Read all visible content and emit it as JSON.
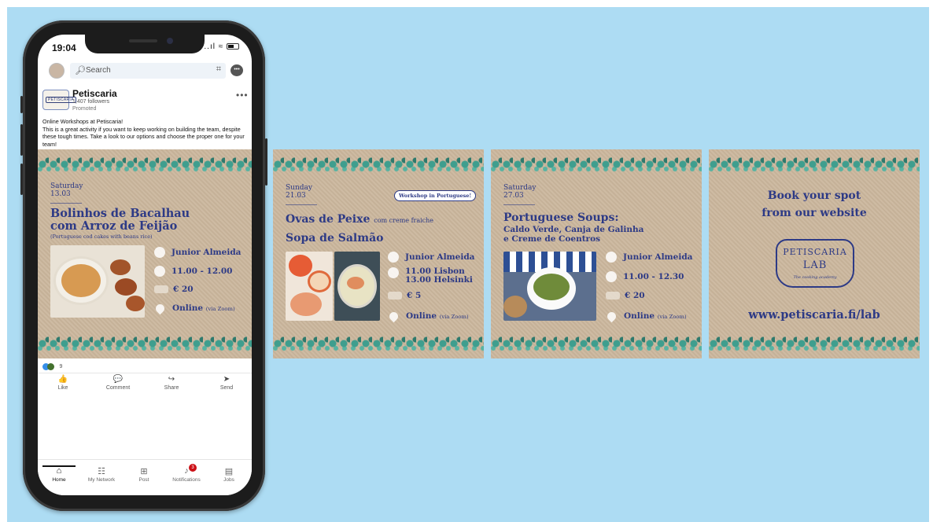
{
  "phone": {
    "status": {
      "time": "19:04",
      "icons": "..ıl ≈"
    },
    "header": {
      "search_placeholder": "Search",
      "search_icon": "search-icon",
      "qr_icon": "qr-icon",
      "message_icon": "messaging-icon"
    },
    "post": {
      "company_name": "Petiscaria",
      "followers": "1,407 followers",
      "promoted": "Promoted",
      "logo_text": "PETISCARIA",
      "more": "•••",
      "text_line1": "Online Workshops at Petiscaria!",
      "text_body": "This is a great activity if you want to keep working on building the team, despite these tough times. Take a look to our options and choose the proper one for your team!",
      "reaction_count": "9"
    },
    "actions": [
      {
        "label": "Like",
        "icon": "👍"
      },
      {
        "label": "Comment",
        "icon": "💬"
      },
      {
        "label": "Share",
        "icon": "↪"
      },
      {
        "label": "Send",
        "icon": "➤"
      }
    ],
    "bottom_nav": [
      {
        "label": "Home",
        "icon": "⌂"
      },
      {
        "label": "My Network",
        "icon": "☷"
      },
      {
        "label": "Post",
        "icon": "⊞"
      },
      {
        "label": "Notifications",
        "icon": "♪",
        "badge": "3"
      },
      {
        "label": "Jobs",
        "icon": "▤"
      }
    ]
  },
  "cards": {
    "bacalhau": {
      "day": "Saturday",
      "date": "13.03",
      "title_line1": "Bolinhos de Bacalhau",
      "title_line2": "com Arroz de Feijão",
      "subtitle": "(Portuguese cod cakes with beans rice)",
      "host": "Junior Almeida",
      "time": "11.00 - 12.00",
      "price": "€ 20",
      "location": "Online",
      "location_note": "(via Zoom)"
    },
    "salmon": {
      "day": "Sunday",
      "date": "21.03",
      "badge": "Workshop in Portuguese!",
      "title_line1": "Ovas de Peixe",
      "title_line1_small": "com creme fraiche",
      "title_line2": "Sopa de Salmão",
      "host": "Junior Almeida",
      "time_line1": "11.00 Lisbon",
      "time_line2": "13.00 Helsinki",
      "price": "€ 5",
      "location": "Online",
      "location_note": "(via Zoom)"
    },
    "soups": {
      "day": "Saturday",
      "date": "27.03",
      "title_line1": "Portuguese Soups:",
      "title_line2": "Caldo Verde, Canja de Galinha",
      "title_line3": "e Creme de Coentros",
      "host": "Junior Almeida",
      "time": "11.00 - 12.30",
      "price": "€ 20",
      "location": "Online",
      "location_note": "(via Zoom)"
    },
    "book": {
      "line1": "Book your spot",
      "line2": "from our website",
      "logo_line1": "PETISCARIA",
      "logo_line2": "LAB",
      "logo_tagline": "The cooking academy",
      "url": "www.petiscaria.fi/lab"
    }
  },
  "colors": {
    "background": "#addcf3",
    "card_text": "#2d3a86",
    "kraft": "#cbb79d",
    "vine": "#3f9e8e"
  }
}
